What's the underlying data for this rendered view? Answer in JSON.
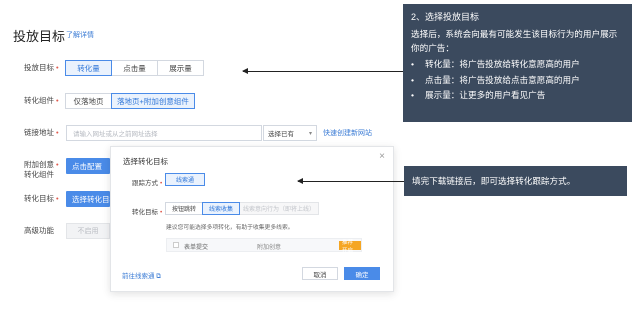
{
  "header": {
    "title": "投放目标",
    "help_link": "了解详情"
  },
  "rows": {
    "target": {
      "label": "投放目标",
      "options": [
        "转化量",
        "点击量",
        "展示量"
      ],
      "selected": "转化量"
    },
    "component": {
      "label": "转化组件",
      "options": [
        "仅落地页",
        "落地页+附加创意组件"
      ],
      "selected": "落地页+附加创意组件"
    },
    "url": {
      "label": "链接地址",
      "placeholder": "请输入网址或从之前网址选择",
      "select_value": "选择已有",
      "quick_link": "快速创建新网站"
    },
    "extra": {
      "label_line1": "附加创意",
      "label_line2": "转化组件",
      "button": "点击配置"
    },
    "conversion_target": {
      "label": "转化目标",
      "button": "选择转化目标"
    },
    "advanced": {
      "label": "高级功能",
      "button": "不启用"
    }
  },
  "modal": {
    "title": "选择转化目标",
    "close": "×",
    "track_label": "跟踪方式",
    "track_value": "线索通",
    "target_label": "转化目标",
    "target_options": [
      "按钮跳转",
      "线索收集",
      "线索意向行为（即将上线）"
    ],
    "target_selected": "线索收集",
    "hint": "建议您可能选择多项转化，有助于收集更多线索。",
    "table_row": {
      "name": "表单提交",
      "desc": "附加创意",
      "badge": "推荐开启"
    },
    "footer_link": "前往线索通",
    "cancel": "取消",
    "ok": "确定"
  },
  "callouts": {
    "first": {
      "heading": "2、选择投放目标",
      "body": "选择后，系统会向最有可能发生该目标行为的用户展示你的广告：",
      "bullets": [
        "转化量：将广告投放给转化意愿高的用户",
        "点击量：将广告投放给点击意愿高的用户",
        "展示量：让更多的用户看见广告"
      ],
      "bullet_symbol": "•"
    },
    "second": {
      "text": "填完下载链接后，即可选择转化跟踪方式。"
    }
  },
  "colors": {
    "accent": "#4a8be8",
    "callout_bg": "#3b4a5e",
    "required": "#e05a4d",
    "badge": "#f5a623"
  }
}
